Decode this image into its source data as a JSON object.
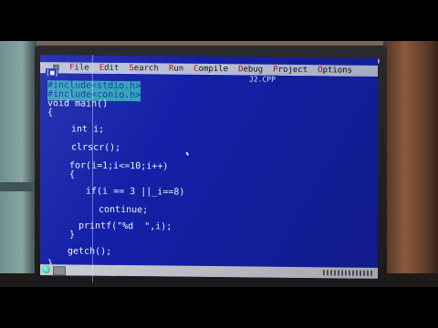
{
  "menu": {
    "items": [
      {
        "label": "File"
      },
      {
        "label": "Edit"
      },
      {
        "label": "Search"
      },
      {
        "label": "Run"
      },
      {
        "label": "Compile"
      },
      {
        "label": "Debug"
      },
      {
        "label": "Project"
      },
      {
        "label": "Options"
      }
    ]
  },
  "window": {
    "filename": "J2.CPP",
    "close_glyph": "[■]"
  },
  "code": {
    "include1": "#include<stdio.h>",
    "include2": "#include<conio.h>",
    "main_decl": "void main()",
    "open_brace": "{",
    "decl": "int i;",
    "clear": "clrscr();",
    "for_stmt": "for(i=1;i<=10;i++)",
    "for_open": "{",
    "if_stmt": "if(i == 3 ||_i==8)",
    "continue_stmt": "continue;",
    "printf_stmt": "printf(\"%d  \",i);",
    "for_close": "}",
    "getch_stmt": "getch();",
    "close_brace": "}"
  },
  "colors": {
    "editor_bg": "#1420a8",
    "menu_bg": "#b8c0d6",
    "selection": "#2fa2b6"
  }
}
